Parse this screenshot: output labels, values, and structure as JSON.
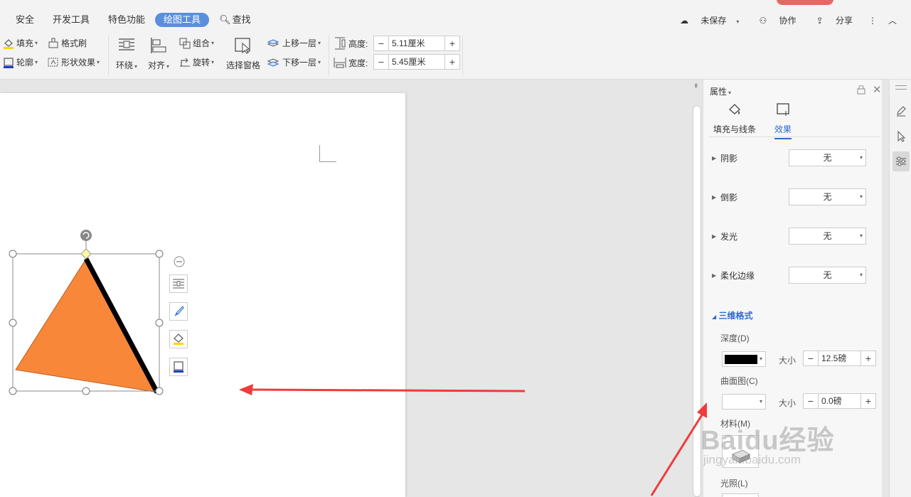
{
  "menubar": {
    "tabs": [
      {
        "label": "安全"
      },
      {
        "label": "开发工具"
      },
      {
        "label": "特色功能"
      },
      {
        "label": "绘图工具",
        "active": true
      },
      {
        "label": "查找"
      }
    ],
    "right": {
      "unsaved": "未保存",
      "collab": "协作",
      "share": "分享"
    }
  },
  "toolbar": {
    "fill": "填充",
    "format_brush": "格式刷",
    "outline": "轮廓",
    "shape_effect": "形状效果",
    "wrap": "环绕",
    "align": "对齐",
    "group": "组合",
    "rotate": "旋转",
    "selection_pane": "选择窗格",
    "bring_forward": "上移一层",
    "send_backward": "下移一层",
    "height_label": "高度:",
    "height_value": "5.11厘米",
    "width_label": "宽度:",
    "width_value": "5.45厘米"
  },
  "panel": {
    "title": "属性",
    "tabs": [
      {
        "label": "填充与线条"
      },
      {
        "label": "效果",
        "active": true
      }
    ],
    "effects": [
      {
        "label": "阴影",
        "value": "无"
      },
      {
        "label": "倒影",
        "value": "无"
      },
      {
        "label": "发光",
        "value": "无"
      },
      {
        "label": "柔化边缘",
        "value": "无"
      }
    ],
    "three_d": {
      "title": "三维格式",
      "depth_label": "深度(D)",
      "depth_color": "#000000",
      "size_label": "大小",
      "depth_size": "12.5磅",
      "contour_label": "曲面图(C)",
      "contour_color": "#ffffff",
      "contour_size": "0.0磅",
      "material_label": "材料(M)",
      "lighting_label": "光照(L)"
    }
  },
  "shape": {
    "fill_color": "#f9873a",
    "edge_color": "#000000"
  },
  "annotations": {
    "arrow_color": "#ef3b3b"
  },
  "watermark": {
    "brand": "Baidu经验",
    "url": "jingyan.baidu.com"
  }
}
